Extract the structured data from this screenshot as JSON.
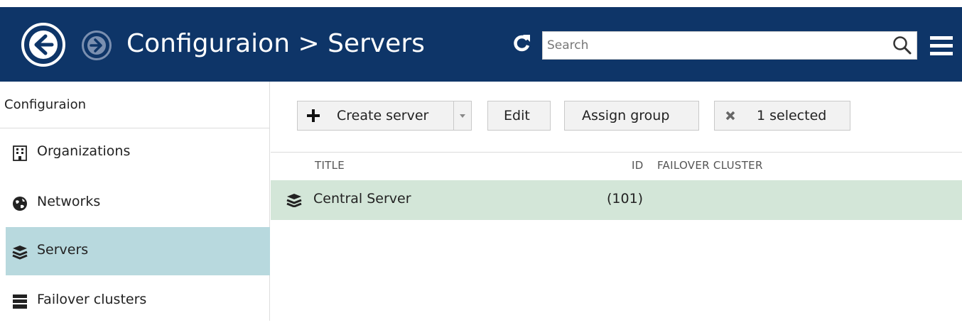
{
  "header": {
    "title": "Configuraion > Servers",
    "search_placeholder": "Search"
  },
  "sidebar": {
    "header": "Configuraion",
    "items": [
      {
        "label": "Organizations",
        "icon": "building-icon"
      },
      {
        "label": "Networks",
        "icon": "globe-icon"
      },
      {
        "label": "Servers",
        "icon": "server-stack-icon",
        "active": true
      },
      {
        "label": "Failover clusters",
        "icon": "cluster-icon"
      }
    ]
  },
  "toolbar": {
    "create_label": "Create server",
    "edit_label": "Edit",
    "assign_label": "Assign group",
    "selected_label": "1 selected"
  },
  "table": {
    "columns": [
      "TITLE",
      "ID",
      "FAILOVER CLUSTER"
    ],
    "rows": [
      {
        "title": "Central Server",
        "id": "(101)",
        "failover_cluster": ""
      }
    ]
  },
  "colors": {
    "header_bg": "#0e3568",
    "active_sidebar": "#b8d9de",
    "selected_row": "#d3e6d8"
  }
}
